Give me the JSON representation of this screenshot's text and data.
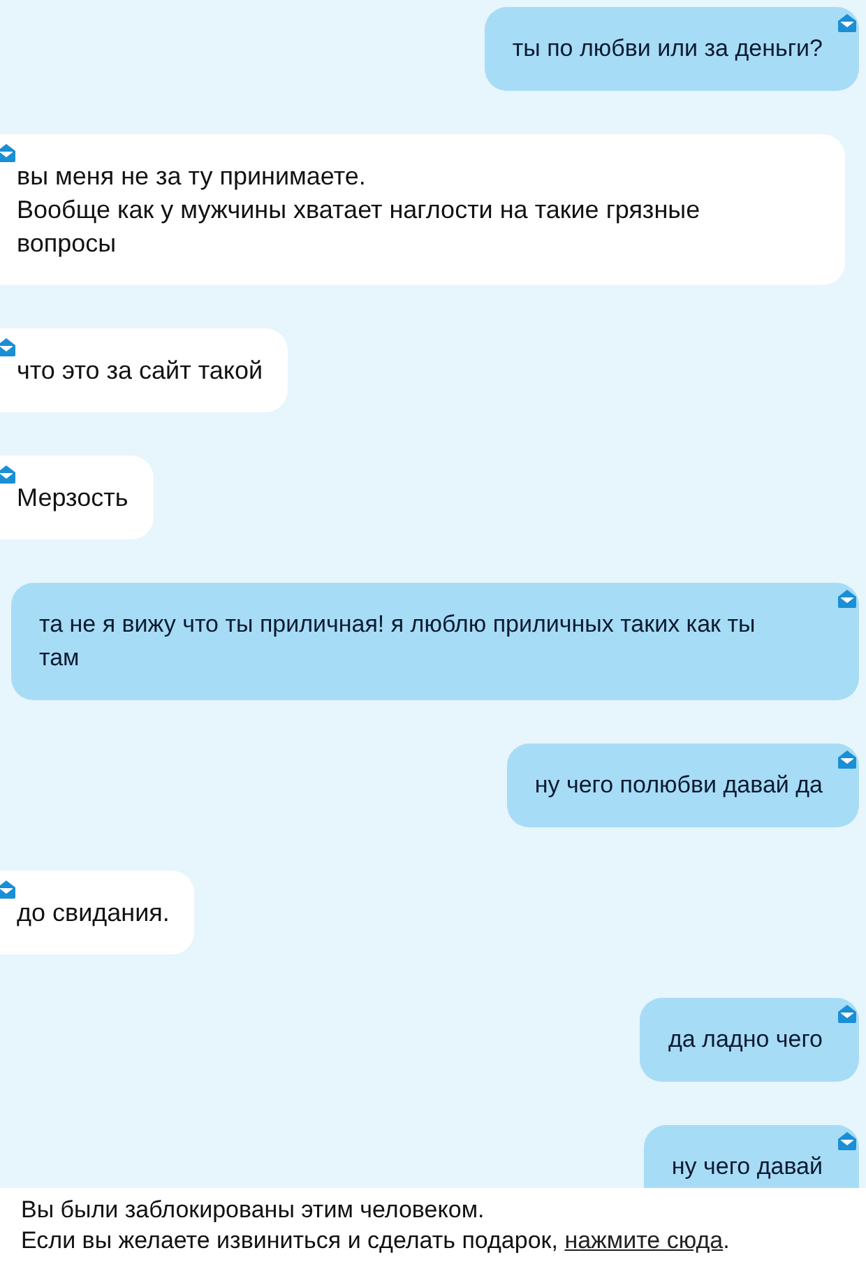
{
  "messages": [
    {
      "kind": "outgoing",
      "text": "ты по любви или за деньги?"
    },
    {
      "kind": "incoming",
      "text": "вы меня не за ту принимаете.\nВообще как у мужчины хватает наглости на такие грязные вопросы"
    },
    {
      "kind": "incoming",
      "text": "что это за сайт такой"
    },
    {
      "kind": "incoming",
      "text": "Мерзость"
    },
    {
      "kind": "outgoing",
      "text": "та не я вижу что ты приличная! я люблю приличных таких как ты там"
    },
    {
      "kind": "outgoing",
      "text": "ну чего полюбви давай да"
    },
    {
      "kind": "incoming",
      "text": "до свидания."
    },
    {
      "kind": "outgoing",
      "text": "да ладно чего"
    },
    {
      "kind": "outgoing",
      "text": "ну чего давай"
    }
  ],
  "notice": {
    "message": "Вы были заблокированы этим человеком.",
    "prompt": "Если вы желаете извиниться и сделать подарок,",
    "link": "нажмите сюда",
    "suffix": "."
  }
}
